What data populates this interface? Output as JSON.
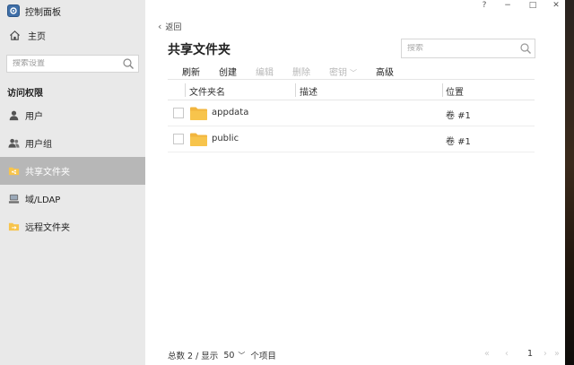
{
  "app": {
    "title": "控制面板"
  },
  "window_controls": [
    "?",
    "−",
    "□",
    "✕"
  ],
  "sidebar": {
    "home_label": "主页",
    "search_placeholder": "搜索设置",
    "section_title": "访问权限",
    "items": [
      {
        "label": "用户",
        "icon": "user-icon",
        "active": false
      },
      {
        "label": "用户组",
        "icon": "group-icon",
        "active": false
      },
      {
        "label": "共享文件夹",
        "icon": "shared-folder-icon",
        "active": true
      },
      {
        "label": "域/LDAP",
        "icon": "domain-icon",
        "active": false
      },
      {
        "label": "远程文件夹",
        "icon": "remote-folder-icon",
        "active": false
      }
    ]
  },
  "main": {
    "back_label": "返回",
    "title": "共享文件夹",
    "search_placeholder": "搜索",
    "toolbar": {
      "refresh": "刷新",
      "create": "创建",
      "edit": "编辑",
      "delete": "删除",
      "password": "密钥",
      "advanced": "高级"
    },
    "columns": {
      "name": "文件夹名",
      "desc": "描述",
      "location": "位置"
    },
    "rows": [
      {
        "name": "appdata",
        "desc": "",
        "location": "卷 #1"
      },
      {
        "name": "public",
        "desc": "",
        "location": "卷 #1"
      }
    ],
    "footer": {
      "total_label": "总数 2 / 显示",
      "page_size": "50",
      "unit": "个项目",
      "first": "«",
      "prev": "‹",
      "page": "1",
      "next": "›",
      "last": "»"
    }
  },
  "colors": {
    "sidebar_bg": "#e9e9e9",
    "active_item_bg": "#b7b7b7",
    "folder_yellow": "#f7c44c",
    "app_icon_blue": "#3f6fa8"
  }
}
